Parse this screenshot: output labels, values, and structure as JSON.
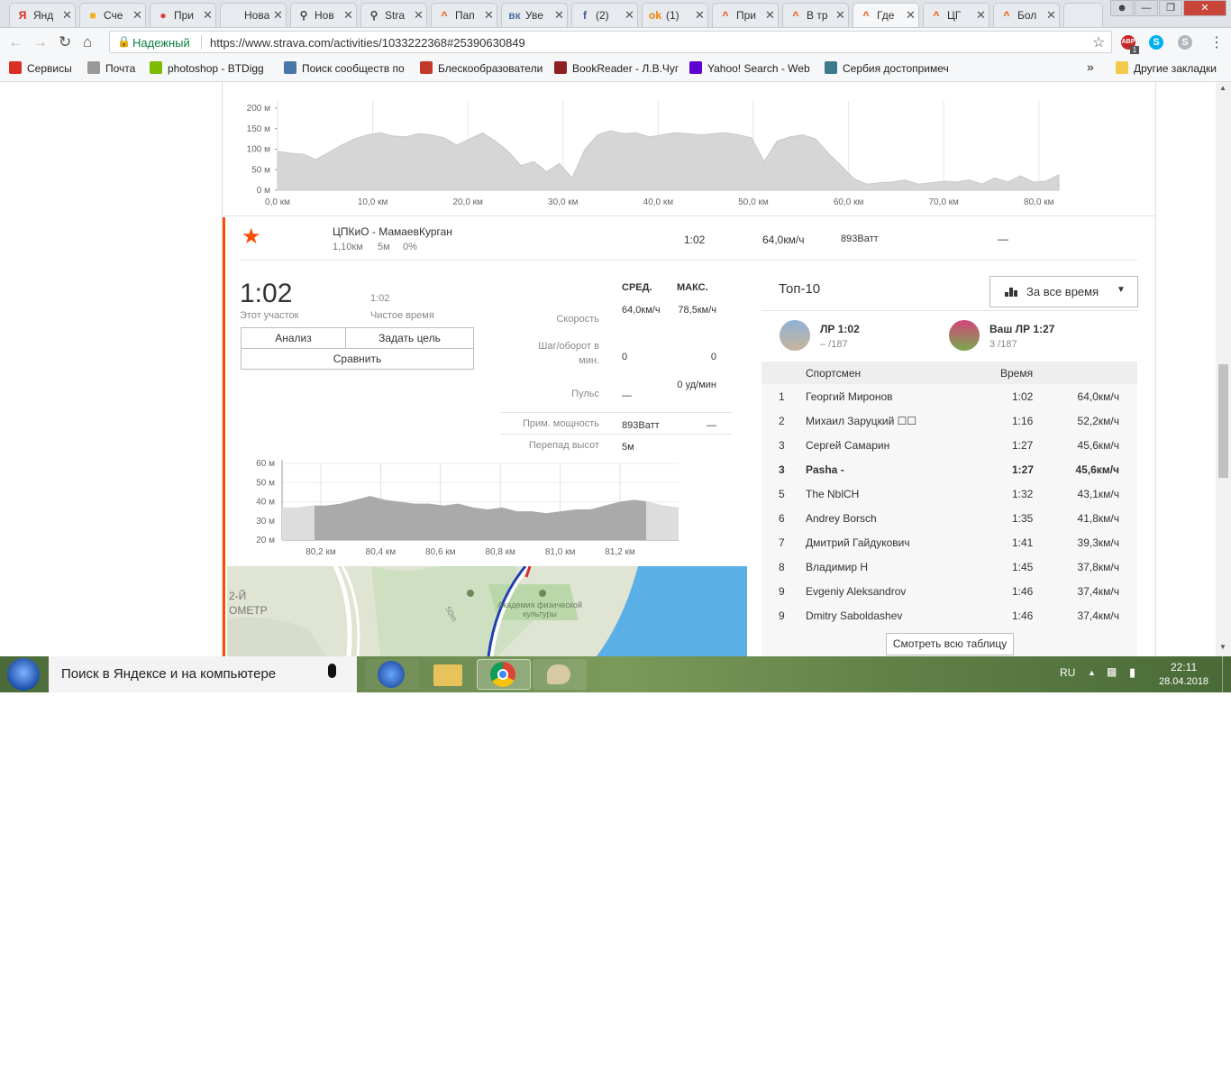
{
  "browser": {
    "tabs": [
      {
        "icon": "Я",
        "icon_color": "#e52620",
        "title": "Янд"
      },
      {
        "icon": "■",
        "icon_color": "#f2b01e",
        "title": "Сче"
      },
      {
        "icon": "●",
        "icon_color": "#e53935",
        "title": "При"
      },
      {
        "icon": "",
        "icon_color": "#dfe3e8",
        "title": "Новая"
      },
      {
        "icon": "⚲",
        "icon_color": "#444444",
        "title": "Нов"
      },
      {
        "icon": "⚲",
        "icon_color": "#444444",
        "title": "Stra"
      },
      {
        "icon": "^",
        "icon_color": "#fc4c02",
        "title": "Пап"
      },
      {
        "icon": "вк",
        "icon_color": "#4a76a8",
        "title": "Уве"
      },
      {
        "icon": "f",
        "icon_color": "#3b5998",
        "title": "(2)"
      },
      {
        "icon": "ok",
        "icon_color": "#ee8208",
        "title": "(1)"
      },
      {
        "icon": "^",
        "icon_color": "#fc4c02",
        "title": "При"
      },
      {
        "icon": "^",
        "icon_color": "#fc4c02",
        "title": "В тр"
      },
      {
        "icon": "^",
        "icon_color": "#fc4c02",
        "title": "Где"
      },
      {
        "icon": "^",
        "icon_color": "#fc4c02",
        "title": "ЦГ"
      },
      {
        "icon": "^",
        "icon_color": "#fc4c02",
        "title": "Бол"
      }
    ],
    "active_tab_index": 12,
    "secure_label": "Надежный",
    "url": "https://www.strava.com/activities/1033222368#25390630849",
    "bookmarks": [
      {
        "label": "Сервисы",
        "icon_color": "#d93025"
      },
      {
        "label": "Почта",
        "icon_color": "#999999"
      },
      {
        "label": "photoshop - BTDigg",
        "icon_color": "#7cbb00"
      },
      {
        "label": "Поиск сообществ по",
        "icon_color": "#4a76a8"
      },
      {
        "label": "Блескообразователи",
        "icon_color": "#c0392b"
      },
      {
        "label": "BookReader - Л.В.Чуг",
        "icon_color": "#8e2020"
      },
      {
        "label": "Yahoo! Search - Web",
        "icon_color": "#5f01d1"
      },
      {
        "label": "Сербия достопримеч",
        "icon_color": "#3a7a8c"
      }
    ],
    "bookmarks_more": "»",
    "other_bookmarks": "Другие закладки",
    "abp_badge": "1"
  },
  "elevation_profile": {
    "y_ticks": [
      "200 м",
      "150 м",
      "100 м",
      "50 м",
      "0 м"
    ],
    "x_ticks": [
      "0,0 км",
      "10,0 км",
      "20,0 км",
      "30,0 км",
      "40,0 км",
      "50,0 км",
      "60,0 км",
      "70,0 км",
      "80,0 км"
    ],
    "samples_m": [
      95,
      90,
      88,
      75,
      92,
      110,
      125,
      135,
      140,
      132,
      130,
      138,
      135,
      128,
      110,
      125,
      140,
      120,
      95,
      60,
      70,
      45,
      65,
      30,
      100,
      135,
      145,
      138,
      140,
      130,
      135,
      140,
      138,
      135,
      138,
      140,
      135,
      128,
      70,
      120,
      130,
      135,
      125,
      90,
      60,
      28,
      15,
      18,
      20,
      25,
      15,
      18,
      22,
      20,
      25,
      15,
      30,
      20,
      35,
      20,
      22,
      38
    ]
  },
  "segment": {
    "name": "ЦПКиО - МамаевКурган",
    "distance": "1,10км",
    "elev_diff": "5м",
    "grade": "0%",
    "time": "1:02",
    "speed": "64,0км/ч",
    "power": "893Ватт",
    "hr": "—"
  },
  "segment_detail": {
    "big_time": "1:02",
    "big_time_label": "Этот участок",
    "moving_time": "1:02",
    "moving_time_label": "Чистое время",
    "btn_analysis": "Анализ",
    "btn_goal": "Задать цель",
    "btn_compare": "Сравнить",
    "col_avg": "СРЕД.",
    "col_max": "МАКС.",
    "stats": [
      {
        "label": "Скорость",
        "avg": "64,0км/ч",
        "max": "78,5км/ч"
      },
      {
        "label": "Шаг/оборот в мин.",
        "avg": "0",
        "max": "0"
      },
      {
        "label": "Пульс",
        "avg": "—",
        "max": "0 уд/мин"
      },
      {
        "label": "Прим. мощность",
        "avg": "893Ватт",
        "max": "—"
      },
      {
        "label": "Перепад высот",
        "avg": "5м",
        "max": ""
      }
    ]
  },
  "segment_profile": {
    "y_ticks": [
      "60 м",
      "50 м",
      "40 м",
      "30 м",
      "20 м"
    ],
    "x_ticks": [
      "80,2 км",
      "80,4 км",
      "80,6 км",
      "80,8 км",
      "81,0 км",
      "81,2 км"
    ],
    "samples_m": [
      37,
      37,
      38,
      38,
      39,
      41,
      43,
      41,
      40,
      39,
      39,
      38,
      39,
      37,
      36,
      37,
      35,
      35,
      34,
      35,
      36,
      36,
      38,
      40,
      41,
      40,
      38,
      37
    ]
  },
  "map_labels": {
    "left_label_1": "2-Й",
    "left_label_2": "ОМЕТР",
    "contour": "50m",
    "academy": "Академия физической культуры"
  },
  "leaderboard": {
    "title": "Топ-10",
    "filter": "За все время",
    "kom_label": "ЛР 1:02",
    "kom_rank": "– /187",
    "your_label": "Ваш ЛР 1:27",
    "your_rank": "3 /187",
    "col_athlete": "Спортсмен",
    "col_time": "Время",
    "rows": [
      {
        "rank": "1",
        "name": "Георгий Миронов",
        "time": "1:02",
        "speed": "64,0км/ч",
        "bold": false
      },
      {
        "rank": "2",
        "name": "Михаил Заруцкий ☐☐",
        "time": "1:16",
        "speed": "52,2км/ч",
        "bold": false
      },
      {
        "rank": "3",
        "name": "Сергей Самарин",
        "time": "1:27",
        "speed": "45,6км/ч",
        "bold": false
      },
      {
        "rank": "3",
        "name": "Pasha -",
        "time": "1:27",
        "speed": "45,6км/ч",
        "bold": true
      },
      {
        "rank": "5",
        "name": "The NblCH",
        "time": "1:32",
        "speed": "43,1км/ч",
        "bold": false
      },
      {
        "rank": "6",
        "name": "Andrey Borsch",
        "time": "1:35",
        "speed": "41,8км/ч",
        "bold": false
      },
      {
        "rank": "7",
        "name": "Дмитрий Гайдукович",
        "time": "1:41",
        "speed": "39,3км/ч",
        "bold": false
      },
      {
        "rank": "8",
        "name": "Владимир Н",
        "time": "1:45",
        "speed": "37,8км/ч",
        "bold": false
      },
      {
        "rank": "9",
        "name": "Evgeniy Aleksandrov",
        "time": "1:46",
        "speed": "37,4км/ч",
        "bold": false
      },
      {
        "rank": "9",
        "name": "Dmitry Saboldashev",
        "time": "1:46",
        "speed": "37,4км/ч",
        "bold": false
      }
    ],
    "see_all": "Смотреть всю таблицу"
  },
  "taskbar": {
    "search_text": "Поиск в Яндексе и на компьютере",
    "lang": "RU",
    "time": "22:11",
    "date": "28.04.2018"
  }
}
